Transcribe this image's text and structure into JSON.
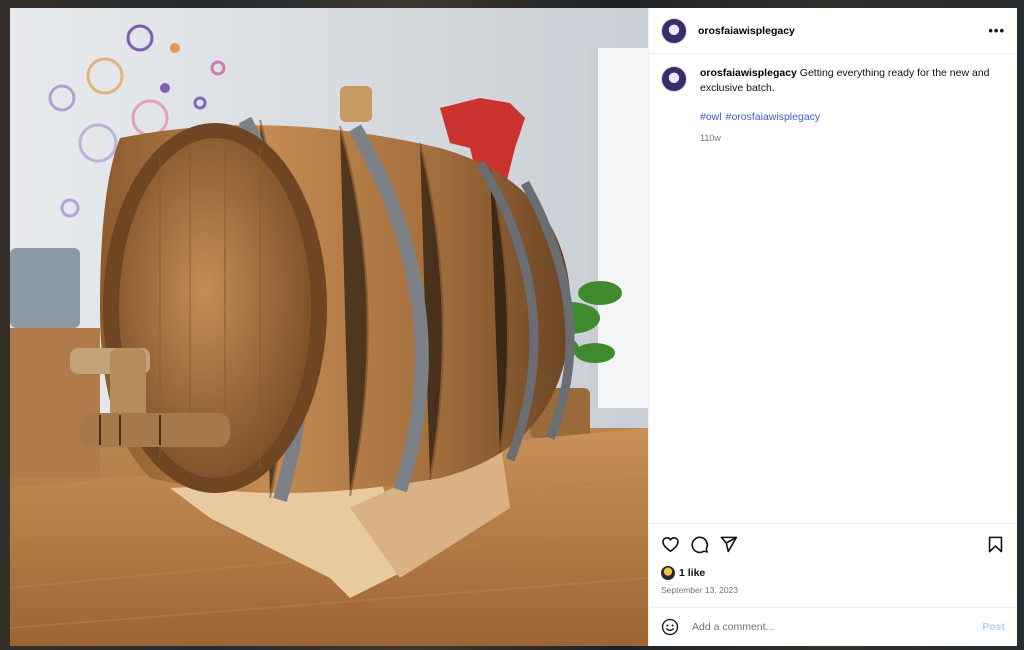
{
  "post": {
    "username": "orosfaiawisplegacy",
    "more_label": "•••",
    "caption": "Getting everything ready for the new and exclusive batch.",
    "hashtags": [
      "#owl",
      "#orosfaiawisplegacy"
    ],
    "time_ago": "110w",
    "likes": "1 like",
    "date": "September 13, 2023"
  },
  "comment_box": {
    "placeholder": "Add a comment...",
    "post_label": "Post"
  },
  "icons": {
    "like": "heart-icon",
    "comment": "comment-bubble-icon",
    "share": "paper-plane-icon",
    "save": "bookmark-icon",
    "emoji": "smiley-icon",
    "more": "more-dots-icon"
  },
  "colors": {
    "hashtag": "#3b5ecf",
    "post_button": "#b2d0f7",
    "secondary_text": "#737373"
  }
}
